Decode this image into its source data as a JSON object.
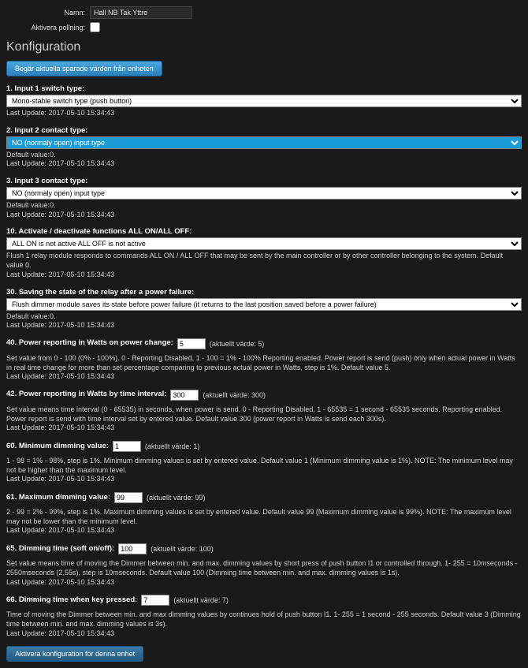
{
  "header": {
    "name_label": "Namn:",
    "name_value": "Hall NB Tak Yttre",
    "polling_label": "Aktivera pollning:"
  },
  "section_title": "Konfiguration",
  "request_button": "Begär aktuella sparade värden från enheten",
  "params": {
    "p1": {
      "label": "1. Input 1 switch type:",
      "selected": "Mono-stable switch type (push button)",
      "last_update": "Last Update: 2017-05-10 15:34:43"
    },
    "p2": {
      "label": "2. Input 2 contact type:",
      "selected": "NO (normaly open) input type",
      "default": "Default value:0.",
      "last_update": "Last Update: 2017-05-10 15:34:43"
    },
    "p3": {
      "label": "3. Input 3 contact type:",
      "selected": "NO (normaly open) input type",
      "default": "Default value:0.",
      "last_update": "Last Update: 2017-05-10 15:34:43"
    },
    "p10": {
      "label": "10. Activate / deactivate functions ALL ON/ALL OFF:",
      "selected": "ALL ON is not active ALL OFF is not active",
      "desc": "Flush 1 relay module responds to commands ALL ON / ALL OFF that may be sent by the main controller or by other controller belonging to the system. Default value 0.",
      "last_update": "Last Update: 2017-05-10 15:34:43"
    },
    "p30": {
      "label": "30. Saving the state of the relay after a power failure:",
      "selected": "Flush dimmer module saves its state before power failure (it returns to the last position saved before a power failure)",
      "default": "Default value:0.",
      "last_update": "Last Update: 2017-05-10 15:34:43"
    },
    "p40": {
      "label": "40. Power reporting in Watts on power change:",
      "value": "5",
      "aktuellt": "(aktuellt värde: 5)",
      "desc": "Set value from 0 - 100 (0% - 100%). 0 - Reporting Disabled. 1 - 100 = 1% - 100% Reporting enabled. Power report is send (push) only when actual power in Watts in real time change for more than set percentage comparing to previous actual power in Watts, step is 1%. Default value 5.",
      "last_update": "Last Update: 2017-05-10 15:34:43"
    },
    "p42": {
      "label": "42. Power reporting in Watts by time interval:",
      "value": "300",
      "aktuellt": "(aktuellt värde: 300)",
      "desc": "Set value means time interval (0 - 65535) in seconds, when power is send. 0 - Reporting Disabled. 1 - 65535 = 1 second - 65535 seconds. Reporting enabled. Power report is send with time interval set by entered value. Default value 300 (power report in Watts is send each 300s).",
      "last_update": "Last Update: 2017-05-10 15:34:43"
    },
    "p60": {
      "label": "60. Minimum dimming value:",
      "value": "1",
      "aktuellt": "(aktuellt värde: 1)",
      "desc": "1 - 98 = 1% - 98%, step is 1%. Minimum dimming values is set by entered value. Default value 1 (Minimum dimming value is 1%). NOTE: The minimum level may not be higher than the maximum level.",
      "last_update": "Last Update: 2017-05-10 15:34:43"
    },
    "p61": {
      "label": "61. Maximum dimming value:",
      "value": "99",
      "aktuellt": "(aktuellt värde: 99)",
      "desc": "2 - 99 = 2% - 99%, step is 1%. Maximum dimming values is set by entered value. Default value 99 (Maximum dimming value is 99%). NOTE: The maximum level may not be lower than the minimum level.",
      "last_update": "Last Update: 2017-05-10 15:34:43"
    },
    "p65": {
      "label": "65. Dimming time (soft on/off):",
      "value": "100",
      "aktuellt": "(aktuellt värde: 100)",
      "desc": "Set value means time of moving the Dimmer between min. and max. dimming values by short press of push button I1 or controlled through. 1- 255 = 10mseconds - 2550mseconds (2,55s), step is 10mseconds. Default value 100 (Dimming time between min. and max. dimming values is 1s).",
      "last_update": "Last Update: 2017-05-10 15:34:43"
    },
    "p66": {
      "label": "66. Dimming time when key pressed:",
      "value": "7",
      "aktuellt": "(aktuellt värde: 7)",
      "desc": "Time of moving the Dimmer between min. and max dimming values by continues hold of push button I1. 1- 255 = 1 second - 255 seconds. Default value 3 (Dimming time between min. and max. dimming values is 3s).",
      "last_update": "Last Update: 2017-05-10 15:34:43"
    }
  },
  "activate_button": "Aktivera konfiguration för denna enhet"
}
